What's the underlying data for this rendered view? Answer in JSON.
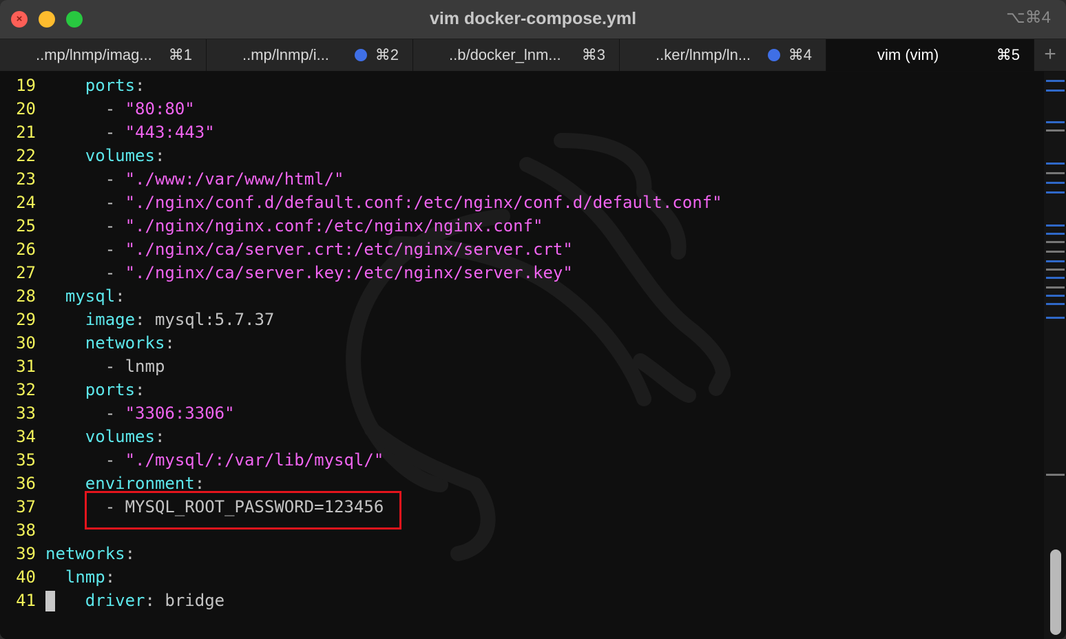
{
  "window": {
    "title": "vim docker-compose.yml",
    "shortcut": "⌥⌘4"
  },
  "tabs": [
    {
      "label": "..mp/lnmp/imag...",
      "key": "⌘1",
      "active": false,
      "dot": false
    },
    {
      "label": "..mp/lnmp/i...",
      "key": "⌘2",
      "active": false,
      "dot": true
    },
    {
      "label": "..b/docker_lnm...",
      "key": "⌘3",
      "active": false,
      "dot": false
    },
    {
      "label": "..ker/lnmp/ln...",
      "key": "⌘4",
      "active": false,
      "dot": true
    },
    {
      "label": "vim (vim)",
      "key": "⌘5",
      "active": true,
      "dot": false
    }
  ],
  "add_tab": "+",
  "colors": {
    "line_number": "#f2f25a",
    "key": "#5de8ec",
    "string": "#f064f0",
    "plain": "#c4c4c4",
    "highlight_box": "#e4141c",
    "tab_dot": "#3f6fe6"
  },
  "editor": {
    "lines": [
      {
        "num": "19",
        "segments": [
          [
            "plain",
            "    "
          ],
          [
            "key",
            "ports"
          ],
          [
            "plain",
            ":"
          ]
        ]
      },
      {
        "num": "20",
        "segments": [
          [
            "plain",
            "      - "
          ],
          [
            "str",
            "\"80:80\""
          ]
        ]
      },
      {
        "num": "21",
        "segments": [
          [
            "plain",
            "      - "
          ],
          [
            "str",
            "\"443:443\""
          ]
        ]
      },
      {
        "num": "22",
        "segments": [
          [
            "plain",
            "    "
          ],
          [
            "key",
            "volumes"
          ],
          [
            "plain",
            ":"
          ]
        ]
      },
      {
        "num": "23",
        "segments": [
          [
            "plain",
            "      - "
          ],
          [
            "str",
            "\"./www:/var/www/html/\""
          ]
        ]
      },
      {
        "num": "24",
        "segments": [
          [
            "plain",
            "      - "
          ],
          [
            "str",
            "\"./nginx/conf.d/default.conf:/etc/nginx/conf.d/default.conf\""
          ]
        ]
      },
      {
        "num": "25",
        "segments": [
          [
            "plain",
            "      - "
          ],
          [
            "str",
            "\"./nginx/nginx.conf:/etc/nginx/nginx.conf\""
          ]
        ]
      },
      {
        "num": "26",
        "segments": [
          [
            "plain",
            "      - "
          ],
          [
            "str",
            "\"./nginx/ca/server.crt:/etc/nginx/server.crt\""
          ]
        ]
      },
      {
        "num": "27",
        "segments": [
          [
            "plain",
            "      - "
          ],
          [
            "str",
            "\"./nginx/ca/server.key:/etc/nginx/server.key\""
          ]
        ]
      },
      {
        "num": "28",
        "segments": [
          [
            "plain",
            "  "
          ],
          [
            "key",
            "mysql"
          ],
          [
            "plain",
            ":"
          ]
        ]
      },
      {
        "num": "29",
        "segments": [
          [
            "plain",
            "    "
          ],
          [
            "key",
            "image"
          ],
          [
            "plain",
            ": mysql:5.7.37"
          ]
        ]
      },
      {
        "num": "30",
        "segments": [
          [
            "plain",
            "    "
          ],
          [
            "key",
            "networks"
          ],
          [
            "plain",
            ":"
          ]
        ]
      },
      {
        "num": "31",
        "segments": [
          [
            "plain",
            "      - lnmp"
          ]
        ]
      },
      {
        "num": "32",
        "segments": [
          [
            "plain",
            "    "
          ],
          [
            "key",
            "ports"
          ],
          [
            "plain",
            ":"
          ]
        ]
      },
      {
        "num": "33",
        "segments": [
          [
            "plain",
            "      - "
          ],
          [
            "str",
            "\"3306:3306\""
          ]
        ]
      },
      {
        "num": "34",
        "segments": [
          [
            "plain",
            "    "
          ],
          [
            "key",
            "volumes"
          ],
          [
            "plain",
            ":"
          ]
        ]
      },
      {
        "num": "35",
        "segments": [
          [
            "plain",
            "      - "
          ],
          [
            "str",
            "\"./mysql/:/var/lib/mysql/\""
          ]
        ]
      },
      {
        "num": "36",
        "segments": [
          [
            "plain",
            "    "
          ],
          [
            "key",
            "environment"
          ],
          [
            "plain",
            ":"
          ]
        ]
      },
      {
        "num": "37",
        "segments": [
          [
            "plain",
            "      - MYSQL_ROOT_PASSWORD=123456"
          ]
        ]
      },
      {
        "num": "38",
        "segments": []
      },
      {
        "num": "39",
        "segments": [
          [
            "key",
            "networks"
          ],
          [
            "plain",
            ":"
          ]
        ]
      },
      {
        "num": "40",
        "segments": [
          [
            "plain",
            "  "
          ],
          [
            "key",
            "lnmp"
          ],
          [
            "plain",
            ":"
          ]
        ]
      },
      {
        "num": "41",
        "segments": [
          [
            "plain",
            "    "
          ],
          [
            "key",
            "driver"
          ],
          [
            "plain",
            ": bridge"
          ]
        ]
      }
    ],
    "cursor_line": "41",
    "highlighted_line": "37"
  }
}
